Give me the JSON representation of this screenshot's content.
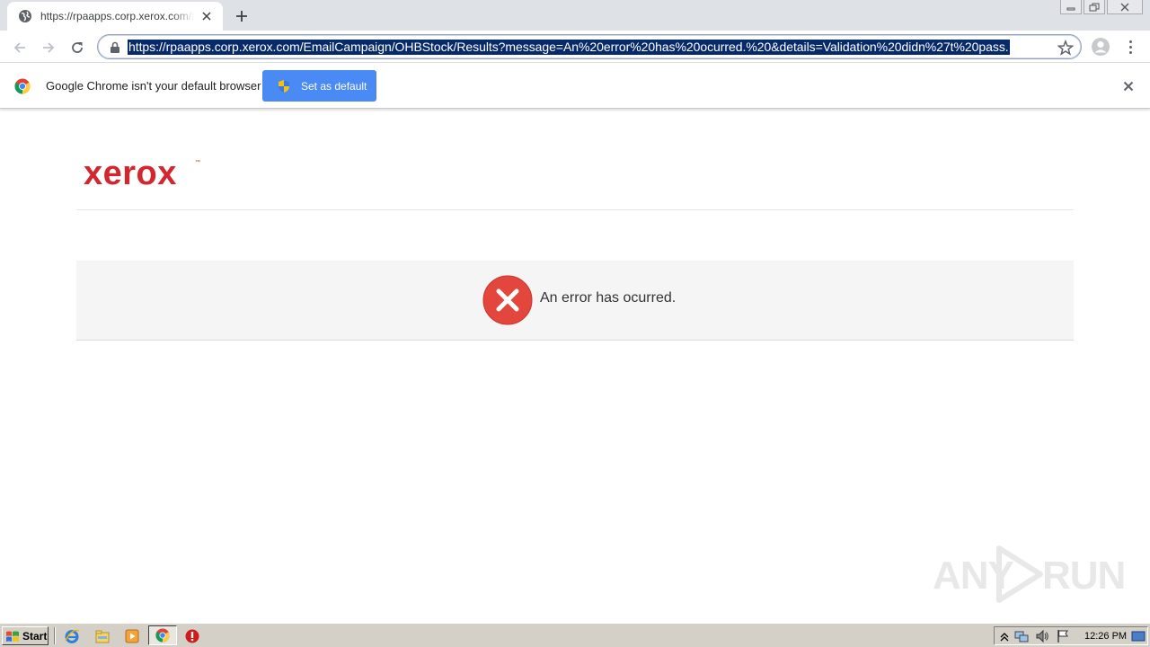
{
  "browser": {
    "tab": {
      "title": "https://rpaapps.corp.xerox.com/EmailCampaign/OHBStock/Results"
    },
    "omnibox": {
      "url": "https://rpaapps.corp.xerox.com/EmailCampaign/OHBStock/Results?message=An%20error%20has%20ocurred.%20&details=Validation%20didn%27t%20pass."
    },
    "infobar": {
      "message": "Google Chrome isn't your default browser",
      "button_label": "Set as default"
    }
  },
  "page": {
    "logo_text": "xerox",
    "logo_tm": "™",
    "error_message": "An error has ocurred.",
    "colors": {
      "brand_red": "#d3262e",
      "error_red": "#e2463c",
      "alert_bg": "#f5f5f5"
    }
  },
  "watermark": {
    "left": "ANY",
    "right": "RUN"
  },
  "taskbar": {
    "start_label": "Start",
    "clock": "12:26 PM"
  }
}
